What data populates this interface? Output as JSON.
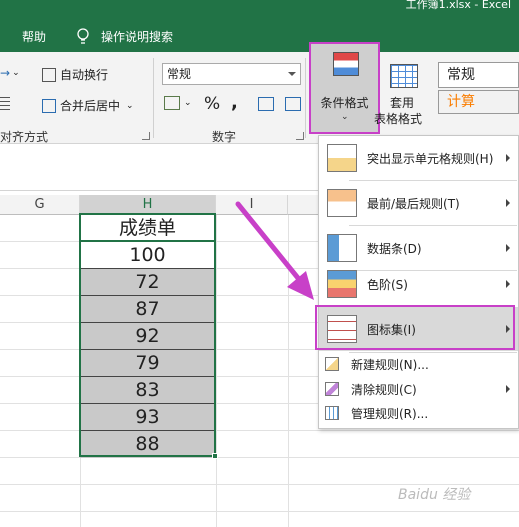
{
  "window": {
    "title": "工作簿1.xlsx  -  Excel"
  },
  "tabs": {
    "help": "帮助",
    "tell_me": "操作说明搜索"
  },
  "ribbon": {
    "alignment": {
      "wrap_text": "自动换行",
      "merge_center": "合并后居中",
      "group_label": "对齐方式"
    },
    "number": {
      "format_value": "常规",
      "percent": "%",
      "comma": ",",
      "group_label": "数字"
    },
    "styles": {
      "conditional_formatting": "条件格式",
      "format_as_table_line1": "套用",
      "format_as_table_line2": "表格格式",
      "style_normal": "常规",
      "style_calc": "计算"
    }
  },
  "grid": {
    "columns": [
      "G",
      "H",
      "I"
    ],
    "header_cell": "成绩单",
    "values": [
      "100",
      "72",
      "87",
      "92",
      "79",
      "83",
      "93",
      "88"
    ]
  },
  "cf_menu": {
    "items": [
      {
        "label": "突出显示单元格规则(H)",
        "icon": "highlight-cells-icon"
      },
      {
        "label": "最前/最后规则(T)",
        "icon": "top-bottom-icon"
      },
      {
        "label": "数据条(D)",
        "icon": "data-bars-icon"
      },
      {
        "label": "色阶(S)",
        "icon": "color-scales-icon"
      },
      {
        "label": "图标集(I)",
        "icon": "icon-sets-icon"
      }
    ],
    "small_items": [
      {
        "label": "新建规则(N)...",
        "icon": "new-rule-icon"
      },
      {
        "label": "清除规则(C)",
        "icon": "clear-rules-icon"
      },
      {
        "label": "管理规则(R)...",
        "icon": "manage-rules-icon"
      }
    ]
  },
  "colors": {
    "excel_green": "#217346",
    "annotation_magenta": "#c840c8"
  },
  "watermark": "Baidu 经验"
}
